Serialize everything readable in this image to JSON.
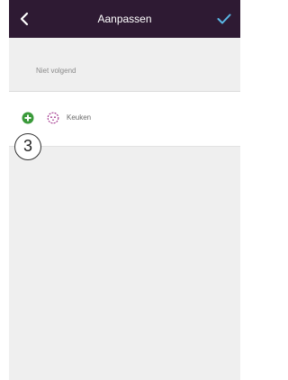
{
  "header": {
    "title": "Aanpassen",
    "background": "#2e1a33",
    "confirm_color": "#5ab8e6"
  },
  "section": {
    "label": "Niet volgend"
  },
  "rows": [
    {
      "label": "Keuken",
      "add_icon": "plus-circle-icon",
      "device_icon": "socket-icon",
      "add_color": "#3a9a3a",
      "device_color": "#a0308a"
    }
  ],
  "annotation": {
    "step": "3"
  }
}
